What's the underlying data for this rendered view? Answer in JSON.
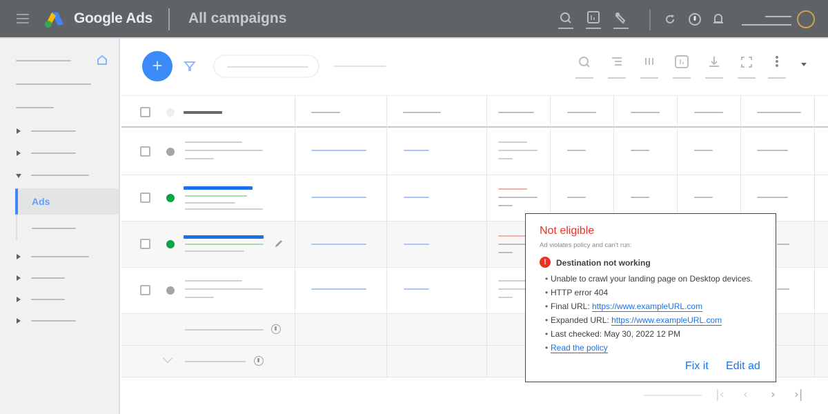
{
  "header": {
    "brand": "Google Ads",
    "page_title": "All campaigns",
    "icons": [
      "search-icon",
      "reports-icon",
      "tools-icon",
      "refresh-icon",
      "help-icon",
      "notifications-icon"
    ]
  },
  "sidebar": {
    "active_item": "Ads",
    "home_icon": "home-icon"
  },
  "toolbar": {
    "add_button": "+",
    "icons": [
      "search-icon",
      "segment-icon",
      "columns-icon",
      "reports-icon",
      "download-icon",
      "expand-icon",
      "more-icon"
    ]
  },
  "popup": {
    "title": "Not eligible",
    "subtitle": "Ad violates policy and can't run:",
    "issue_icon": "!",
    "issue_title": "Destination not working",
    "bullet": "•",
    "details": [
      {
        "text": "Unable to crawl your landing page on Desktop devices."
      },
      {
        "text": "HTTP error 404"
      },
      {
        "label": "Final URL: ",
        "link": "https://www.exampleURL.com"
      },
      {
        "label": "Expanded URL: ",
        "link": "https://www.exampleURL.com"
      },
      {
        "text": "Last checked: May 30, 2022 12 PM"
      },
      {
        "link": "Read the policy"
      }
    ],
    "fix_button": "Fix it",
    "edit_button": "Edit ad"
  },
  "pagination": {
    "first": "|‹",
    "prev": "‹",
    "next": "›",
    "last": "›|"
  },
  "colors": {
    "header_bg": "#5f6368",
    "accent_blue": "#1a73e8",
    "error_red": "#ea3323",
    "status_green": "#1e8e3e"
  }
}
